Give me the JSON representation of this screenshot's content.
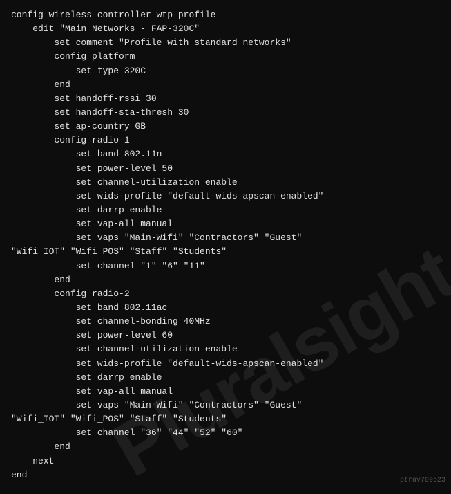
{
  "code": {
    "lines": [
      "config wireless-controller wtp-profile",
      "    edit \"Main Networks - FAP-320C\"",
      "        set comment \"Profile with standard networks\"",
      "        config platform",
      "            set type 320C",
      "        end",
      "        set handoff-rssi 30",
      "        set handoff-sta-thresh 30",
      "        set ap-country GB",
      "        config radio-1",
      "            set band 802.11n",
      "            set power-level 50",
      "            set channel-utilization enable",
      "            set wids-profile \"default-wids-apscan-enabled\"",
      "            set darrp enable",
      "            set vap-all manual",
      "            set vaps \"Main-Wifi\" \"Contractors\" \"Guest\"",
      "\"Wifi_IOT\" \"Wifi_POS\" \"Staff\" \"Students\"",
      "            set channel \"1\" \"6\" \"11\"",
      "        end",
      "        config radio-2",
      "            set band 802.11ac",
      "            set channel-bonding 40MHz",
      "            set power-level 60",
      "            set channel-utilization enable",
      "            set wids-profile \"default-wids-apscan-enabled\"",
      "            set darrp enable",
      "            set vap-all manual",
      "            set vaps \"Main-Wifi\" \"Contractors\" \"Guest\"",
      "\"Wifi_IOT\" \"Wifi_POS\" \"Staff\" \"Students\"",
      "            set channel \"36\" \"44\" \"52\" \"60\"",
      "        end",
      "    next",
      "end"
    ],
    "watermark_text": "Pluralsight",
    "id_label": "ptrav709523"
  }
}
